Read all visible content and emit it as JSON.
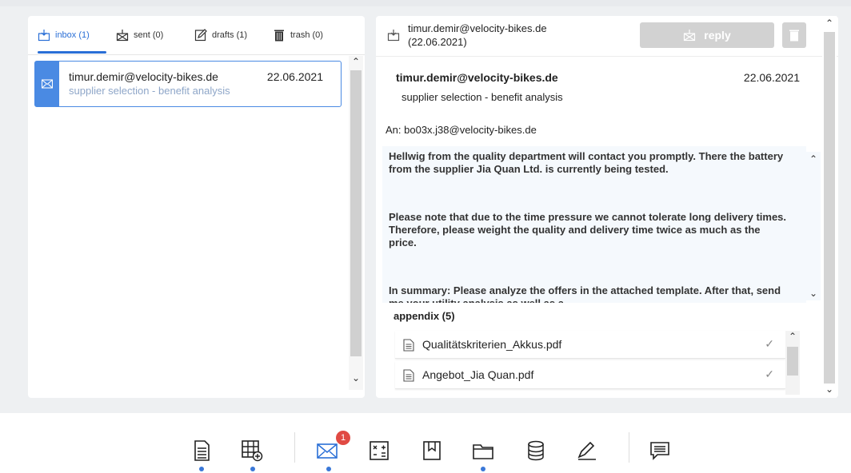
{
  "colors": {
    "accent": "#2a6fd6",
    "mail_badge": "#4a8ae3",
    "notification": "#e04a43",
    "dot": "#3a78d8"
  },
  "tabs": [
    {
      "label": "inbox (1)",
      "icon": "inbox-icon",
      "active": true
    },
    {
      "label": "sent (0)",
      "icon": "sent-icon",
      "active": false
    },
    {
      "label": "drafts (1)",
      "icon": "drafts-icon",
      "active": false
    },
    {
      "label": "trash (0)",
      "icon": "trash-icon",
      "active": false
    }
  ],
  "mail_list": [
    {
      "from": "timur.demir@velocity-bikes.de",
      "date": "22.06.2021",
      "subject": "supplier selection - benefit analysis",
      "selected": true
    }
  ],
  "viewer": {
    "header_title_line1": "timur.demir@velocity-bikes.de",
    "header_title_line2": "(22.06.2021)",
    "reply_label": "reply",
    "from": "timur.demir@velocity-bikes.de",
    "date": "22.06.2021",
    "subject": "supplier selection - benefit analysis",
    "to": "An: bo03x.j38@velocity-bikes.de",
    "body": [
      "Hellwig from the quality department will contact you promptly. There the battery from the supplier Jia Quan Ltd. is currently being tested.",
      "Please note that due to the time pressure we cannot tolerate long delivery times. Therefore, please weight the quality and delivery time twice as much as the price.",
      "In summary: Please analyze the offers in the attached template. After that, send me your utility analysis as well as a"
    ],
    "appendix_title": "appendix (5)",
    "attachments": [
      {
        "name": "Qualitätskriterien_Akkus.pdf",
        "check": "✓"
      },
      {
        "name": "Angebot_Jia Quan.pdf",
        "check": "✓"
      }
    ]
  },
  "toolbar": {
    "items": [
      {
        "icon": "document-icon",
        "dot": true
      },
      {
        "icon": "table-add-icon",
        "dot": true
      },
      {
        "icon": "mail-icon",
        "dot": true,
        "badge": "1"
      },
      {
        "icon": "calculator-icon",
        "dot": false
      },
      {
        "icon": "book-icon",
        "dot": false
      },
      {
        "icon": "folder-icon",
        "dot": true
      },
      {
        "icon": "database-icon",
        "dot": false
      },
      {
        "icon": "pen-icon",
        "dot": false
      },
      {
        "icon": "chat-icon",
        "dot": false
      }
    ]
  }
}
